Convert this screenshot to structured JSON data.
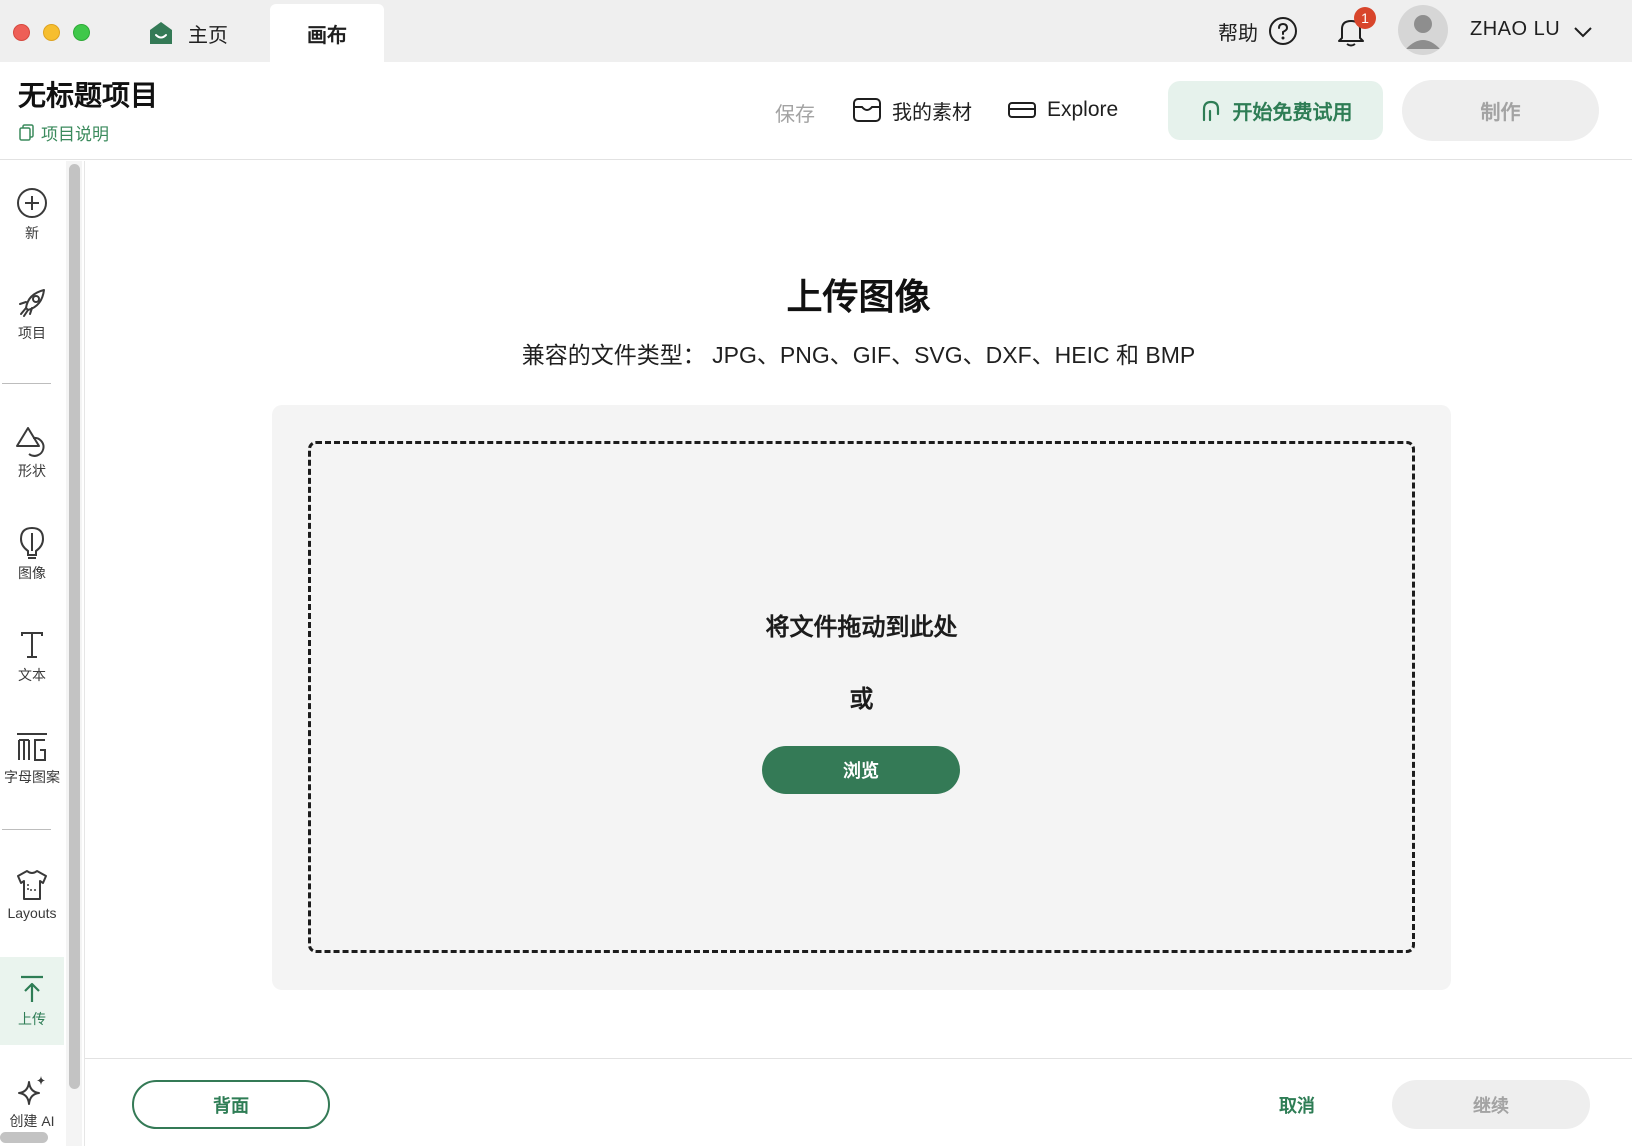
{
  "titlebar": {
    "tabs": [
      {
        "label": "主页",
        "icon": "home-icon"
      },
      {
        "label": "画布"
      }
    ],
    "help_label": "帮助",
    "notifications_count": "1",
    "username": "ZHAO LU"
  },
  "header": {
    "project_title": "无标题项目",
    "project_description_link": "项目说明",
    "save_label": "保存",
    "my_assets_label": "我的素材",
    "explore_label": "Explore",
    "trial_label": "开始免费试用",
    "make_label": "制作"
  },
  "sidebar": {
    "items": [
      {
        "label": "新",
        "icon": "plus-circle-icon"
      },
      {
        "label": "项目",
        "icon": "rocket-icon"
      },
      {
        "label": "形状",
        "icon": "shapes-icon"
      },
      {
        "label": "图像",
        "icon": "lightbulb-icon"
      },
      {
        "label": "文本",
        "icon": "text-icon"
      },
      {
        "label": "字母图案",
        "icon": "monogram-icon"
      },
      {
        "label": "Layouts",
        "icon": "tshirt-icon"
      },
      {
        "label": "上传",
        "icon": "upload-icon",
        "active": true
      },
      {
        "label": "创建 AI",
        "icon": "sparkle-icon"
      }
    ]
  },
  "main": {
    "title": "上传图像",
    "subtitle": "兼容的文件类型：   JPG、PNG、GIF、SVG、DXF、HEIC 和 BMP",
    "drop_text": "将文件拖动到此处",
    "or_text": "或",
    "browse_label": "浏览"
  },
  "footer": {
    "back_label": "背面",
    "cancel_label": "取消",
    "continue_label": "继续"
  },
  "colors": {
    "brand_green": "#347a56",
    "active_bg": "#eaf4ee",
    "badge_red": "#d8452b",
    "disabled_gray": "#a3a3a3"
  }
}
